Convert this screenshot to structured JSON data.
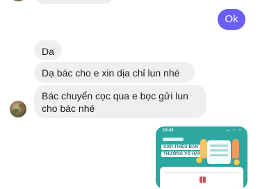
{
  "conversation": {
    "outgoing": [
      {
        "text": "Ok"
      }
    ],
    "incoming": [
      {
        "text": "Da"
      },
      {
        "text": "Dạ bác cho e xin dịa chỉ lun nhé"
      },
      {
        "text": "Bác chuyển cọc qua e bọc gửi lun cho bác nhé"
      }
    ]
  },
  "shared_screenshot": {
    "status_time": "10:43",
    "headline_line1": "GIỚI THIỆU BẠN",
    "headline_line2": "THƯỞNG VÔ HẠN"
  },
  "colors": {
    "outgoing_bubble": "#6b5ef5",
    "incoming_bubble": "#efefef",
    "screenshot_bg": "#2ea7a1"
  }
}
